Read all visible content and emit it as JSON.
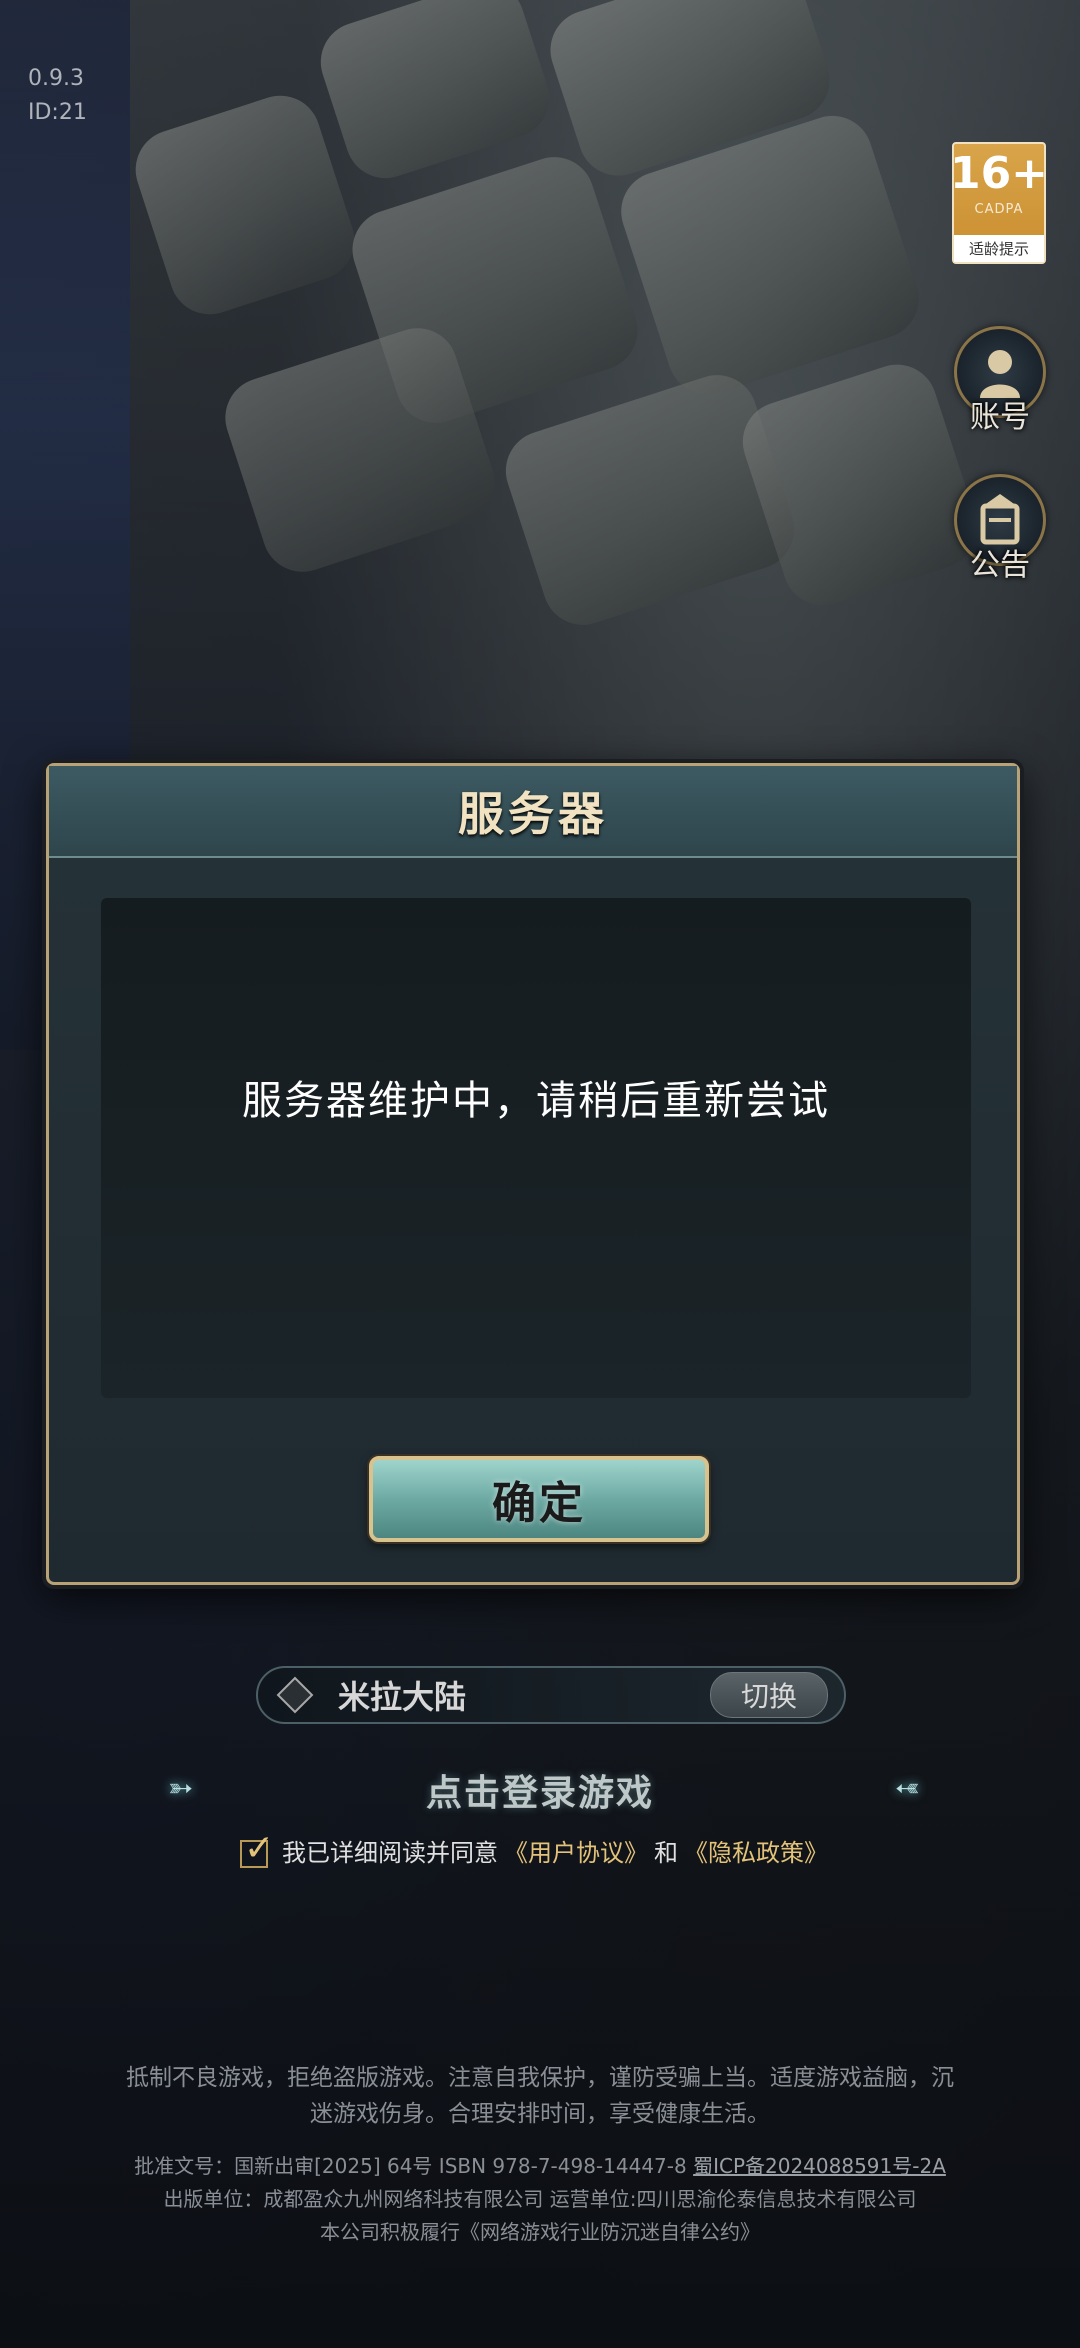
{
  "version": {
    "number": "0.9.3",
    "id": "ID:21"
  },
  "side_buttons": {
    "age_rating": {
      "number": "16+",
      "org": "CADPA",
      "tip": "适龄提示"
    },
    "account_label": "账号",
    "notice_label": "公告"
  },
  "dialog": {
    "title": "服务器",
    "message": "服务器维护中，请稍后重新尝试",
    "confirm_label": "确定"
  },
  "server": {
    "name": "米拉大陆",
    "switch_label": "切换"
  },
  "login": {
    "label": "点击登录游戏"
  },
  "agreement": {
    "prefix": "我已详细阅读并同意",
    "user_agreement": "《用户协议》",
    "and": "和",
    "privacy_policy": "《隐私政策》",
    "checked": true
  },
  "footer": {
    "health_notice": "抵制不良游戏，拒绝盗版游戏。注意自我保护，谨防受骗上当。适度游戏益脑，沉迷游戏伤身。合理安排时间，享受健康生活。",
    "approval": "批准文号：国新出审[2025] 64号 ISBN 978-7-498-14447-8",
    "icp": "蜀ICP备2024088591号-2A",
    "publisher": "出版单位：成都盈众九州网络科技有限公司 运营单位:四川思渝伦泰信息技术有限公司",
    "pledge": "本公司积极履行《网络游戏行业防沉迷自律公约》"
  }
}
